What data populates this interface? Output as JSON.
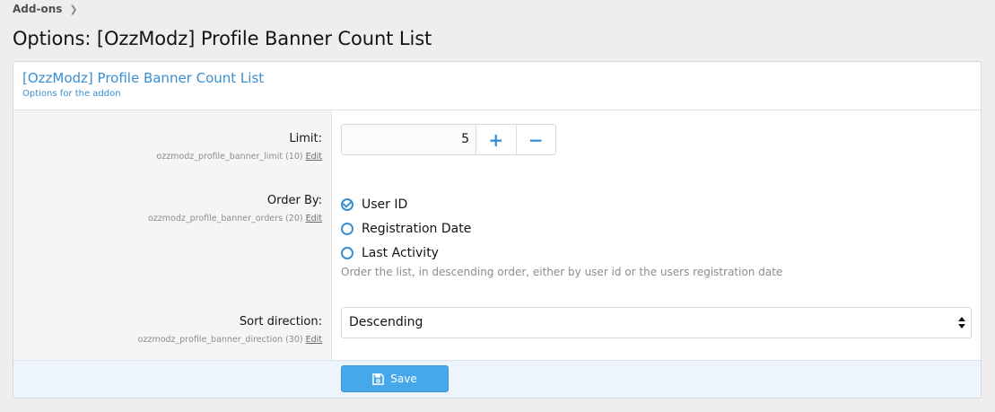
{
  "breadcrumb": {
    "items": [
      "Add-ons"
    ]
  },
  "page": {
    "title": "Options: [OzzModz] Profile Banner Count List"
  },
  "panel": {
    "title": "[OzzModz] Profile Banner Count List",
    "description": "Options for the addon"
  },
  "options": {
    "limit": {
      "label": "Limit:",
      "key": "ozzmodz_profile_banner_limit (10)",
      "edit_label": "Edit",
      "value": "5",
      "increment_label": "+",
      "decrement_label": "−"
    },
    "order_by": {
      "label": "Order By:",
      "key": "ozzmodz_profile_banner_orders (20)",
      "edit_label": "Edit",
      "choices": [
        {
          "label": "User ID",
          "checked": true
        },
        {
          "label": "Registration Date",
          "checked": false
        },
        {
          "label": "Last Activity",
          "checked": false
        }
      ],
      "explain": "Order the list, in descending order, either by user id or the users registration date"
    },
    "sort_direction": {
      "label": "Sort direction:",
      "key": "ozzmodz_profile_banner_direction (30)",
      "edit_label": "Edit",
      "selected": "Descending"
    }
  },
  "footer": {
    "save_label": "Save",
    "save_icon": "floppy-disk-icon"
  },
  "colors": {
    "accent": "#3a8fd0",
    "button": "#47a7eb",
    "footer_bg": "#edf4fb"
  }
}
